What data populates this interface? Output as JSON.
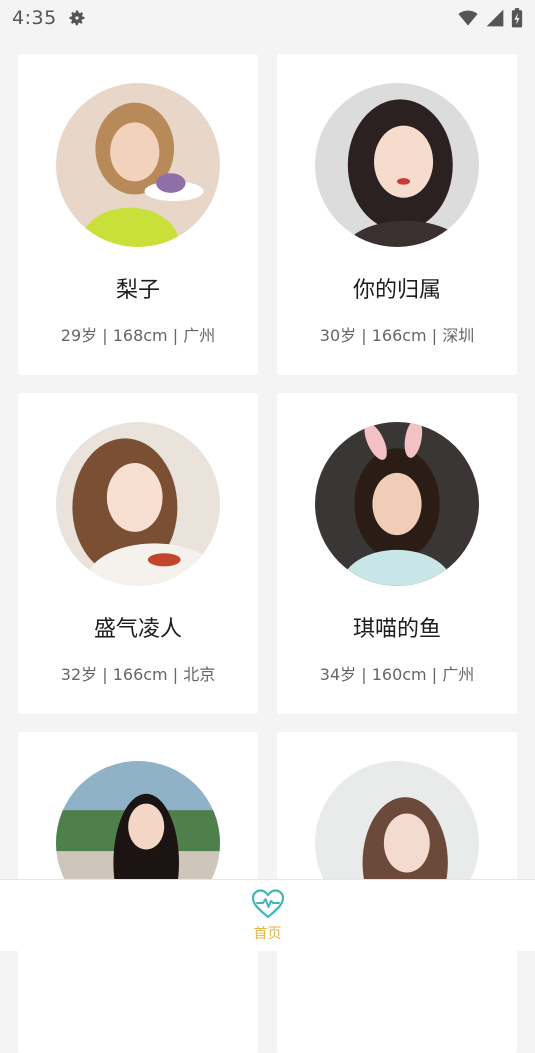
{
  "status": {
    "time": "4:35",
    "icons": [
      "gear-icon",
      "wifi-icon",
      "cell-signal-icon",
      "battery-charging-icon"
    ]
  },
  "profiles": [
    {
      "name": "梨子",
      "info": "29岁 | 168cm | 广州",
      "palette": {
        "bg": "#e8d7c8",
        "hair": "#b88a5a",
        "skin": "#f2d2bd",
        "top": "#c9e03a"
      }
    },
    {
      "name": "你的归属",
      "info": "30岁 | 166cm | 深圳",
      "palette": {
        "bg": "#dcdcdc",
        "hair": "#2a2120",
        "skin": "#f5dccd",
        "top": "#3a3030"
      }
    },
    {
      "name": "盛气凌人",
      "info": "32岁 | 166cm | 北京",
      "palette": {
        "bg": "#e9e3dc",
        "hair": "#7a4f34",
        "skin": "#f7e0d2",
        "top": "#f5f2ee"
      }
    },
    {
      "name": "琪喵的鱼",
      "info": "34岁 | 160cm | 广州",
      "palette": {
        "bg": "#3a3636",
        "hair": "#2b1c16",
        "skin": "#f0cdb6",
        "top": "#c8e6e8"
      }
    },
    {
      "name": "",
      "info": "",
      "palette": {
        "bg": "#8fb2c9",
        "hair": "#1b1413",
        "skin": "#f3d6c6",
        "top": "#2a2a2a"
      }
    },
    {
      "name": "",
      "info": "",
      "palette": {
        "bg": "#e8ebe9",
        "hair": "#6b4a3c",
        "skin": "#f3dbcf",
        "top": "#cfcfcf"
      }
    }
  ],
  "tabbar": {
    "home_label": "首页",
    "accent": "#3cb8b8",
    "label_color": "#e0b64a"
  }
}
